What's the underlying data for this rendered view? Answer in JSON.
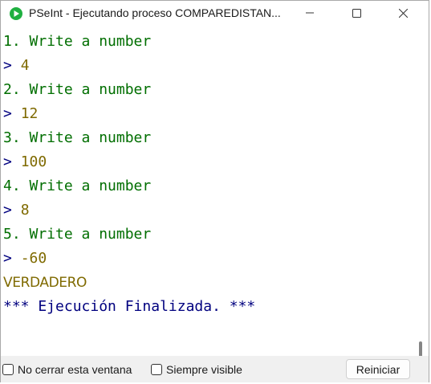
{
  "window": {
    "title": "PSeInt - Ejecutando proceso COMPAREDISTAN...",
    "icon": "pseint-logo-icon",
    "controls": {
      "minimize": "minimize-icon",
      "maximize": "maximize-icon",
      "close": "close-icon"
    }
  },
  "colors": {
    "prompt": "#00007f",
    "question": "#006e00",
    "input_value": "#7f6a00",
    "result": "#7f6a00",
    "end_message": "#00007f",
    "app_icon": "#1fb040"
  },
  "console": {
    "lines": [
      {
        "type": "question",
        "text": "1. Write a number"
      },
      {
        "type": "input",
        "prompt": "> ",
        "value": "4"
      },
      {
        "type": "question",
        "text": "2. Write a number"
      },
      {
        "type": "input",
        "prompt": "> ",
        "value": "12"
      },
      {
        "type": "question",
        "text": "3. Write a number"
      },
      {
        "type": "input",
        "prompt": "> ",
        "value": "100"
      },
      {
        "type": "question",
        "text": "4. Write a number"
      },
      {
        "type": "input",
        "prompt": "> ",
        "value": "8"
      },
      {
        "type": "question",
        "text": "5. Write a number"
      },
      {
        "type": "input",
        "prompt": "> ",
        "value": "-60"
      },
      {
        "type": "result",
        "text": "VERDADERO"
      },
      {
        "type": "end",
        "text": "*** Ejecución Finalizada. ***"
      }
    ]
  },
  "bottom": {
    "no_cerrar_label": "No cerrar esta ventana",
    "no_cerrar_checked": false,
    "siempre_visible_label": "Siempre visible",
    "siempre_visible_checked": false,
    "reiniciar_label": "Reiniciar"
  }
}
